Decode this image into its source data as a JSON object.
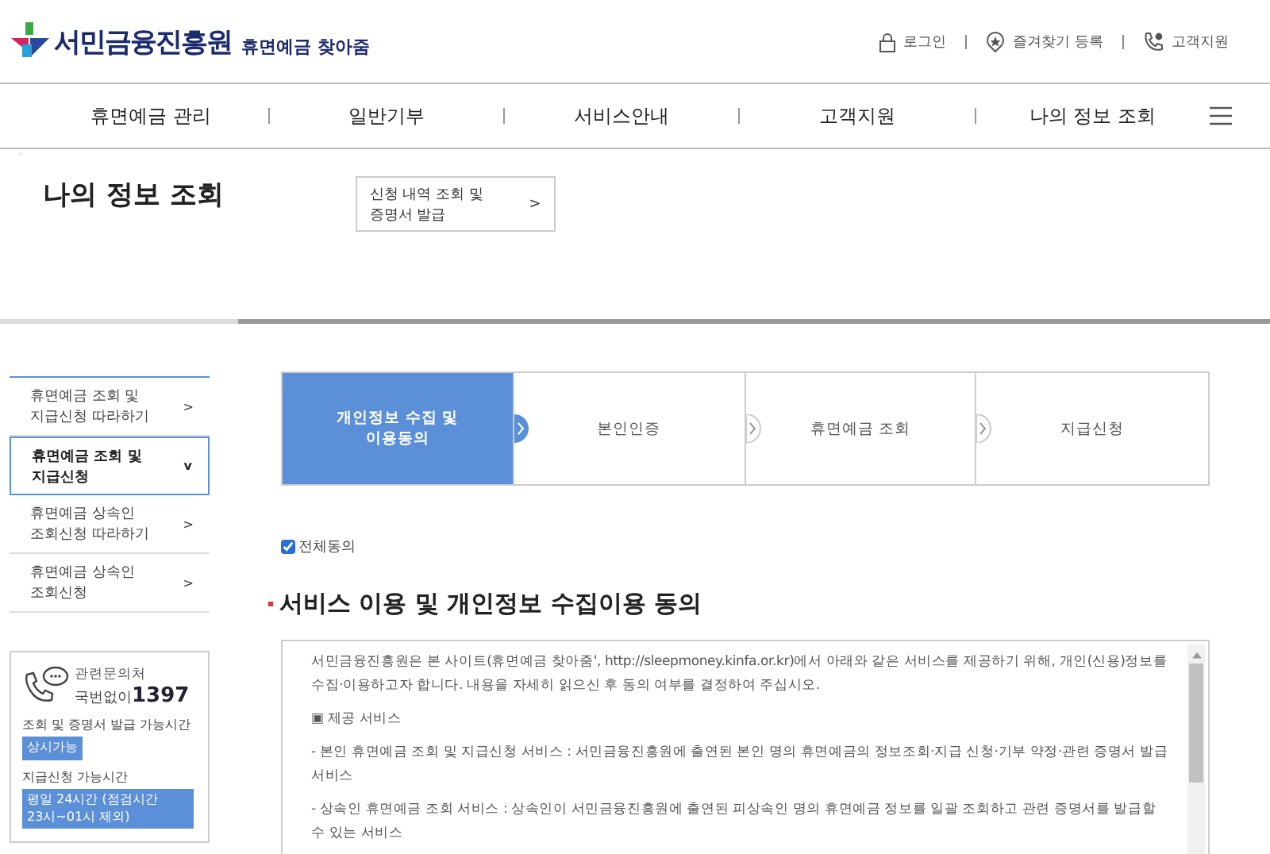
{
  "header": {
    "logo": "서민금융진흥원",
    "subtitle": "휴면예금 찾아줌",
    "utility_links": [
      {
        "kind": "lock",
        "label": "로그인"
      },
      {
        "kind": "star",
        "label": "즐겨찾기 등록"
      },
      {
        "kind": "phone",
        "label": "고객지원"
      }
    ]
  },
  "nav": {
    "items": [
      "휴면예금 관리",
      "일반기부",
      "서비스안내",
      "고객지원",
      "나의 정보 조회"
    ]
  },
  "page_title": "나의 정보 조회",
  "sub_link": {
    "label": "신청 내역 조회 및 증명서 발급",
    "arrow": ">"
  },
  "sidebar": {
    "items": [
      {
        "label": "휴면예금 조회 및 지급신청 따라하기",
        "chevron": ">",
        "selected": false
      },
      {
        "label": "휴면예금 조회 및 지급신청",
        "chevron": "v",
        "selected": true
      },
      {
        "label": "휴면예금 상속인 조회신청 따라하기",
        "chevron": ">",
        "selected": false
      },
      {
        "label": "휴면예금 상속인 조회신청",
        "chevron": ">",
        "selected": false
      }
    ]
  },
  "contact": {
    "label": "관련문의처",
    "prefix": "국번없이",
    "number": "1397",
    "hours": [
      {
        "label": "조회 및 증명서 발급 가능시간",
        "value": "상시가능"
      },
      {
        "label": "지급신청 가능시간",
        "value": "평일 24시간 (점검시간 23시~01시 제외)"
      }
    ]
  },
  "steps": [
    {
      "label": "개인정보 수집 및 이용동의",
      "selected": true
    },
    {
      "label": "본인인증",
      "selected": false
    },
    {
      "label": "휴면예금 조회",
      "selected": false
    },
    {
      "label": "지급신청",
      "selected": false
    }
  ],
  "agree_all": {
    "label": "전체동의",
    "checked": true
  },
  "section_title": "서비스 이용 및 개인정보 수집이용 동의",
  "consent": {
    "paragraphs": [
      "서민금융진흥원은 본 사이트(휴면예금 찾아줌', http://sleepmoney.kinfa.or.kr)에서 아래와 같은 서비스를 제공하기 위해, 개인(신용)정보를 수집·이용하고자 합니다. 내용을 자세히 읽으신 후 동의 여부를 결정하여 주십시오.",
      "▣ 제공 서비스",
      "- 본인 휴면예금 조회 및 지급신청 서비스 : 서민금융진흥원에 출연된 본인 명의 휴면예금의 정보조회·지급 신청·기부 약정·관련 증명서 발급 서비스",
      "- 상속인 휴면예금 조회 서비스 : 상속인이 서민금융진흥원에 출연된 피상속인 명의 휴면예금 정보를 일괄 조회하고 관련 증명서를 발급할 수 있는 서비스"
    ]
  }
}
